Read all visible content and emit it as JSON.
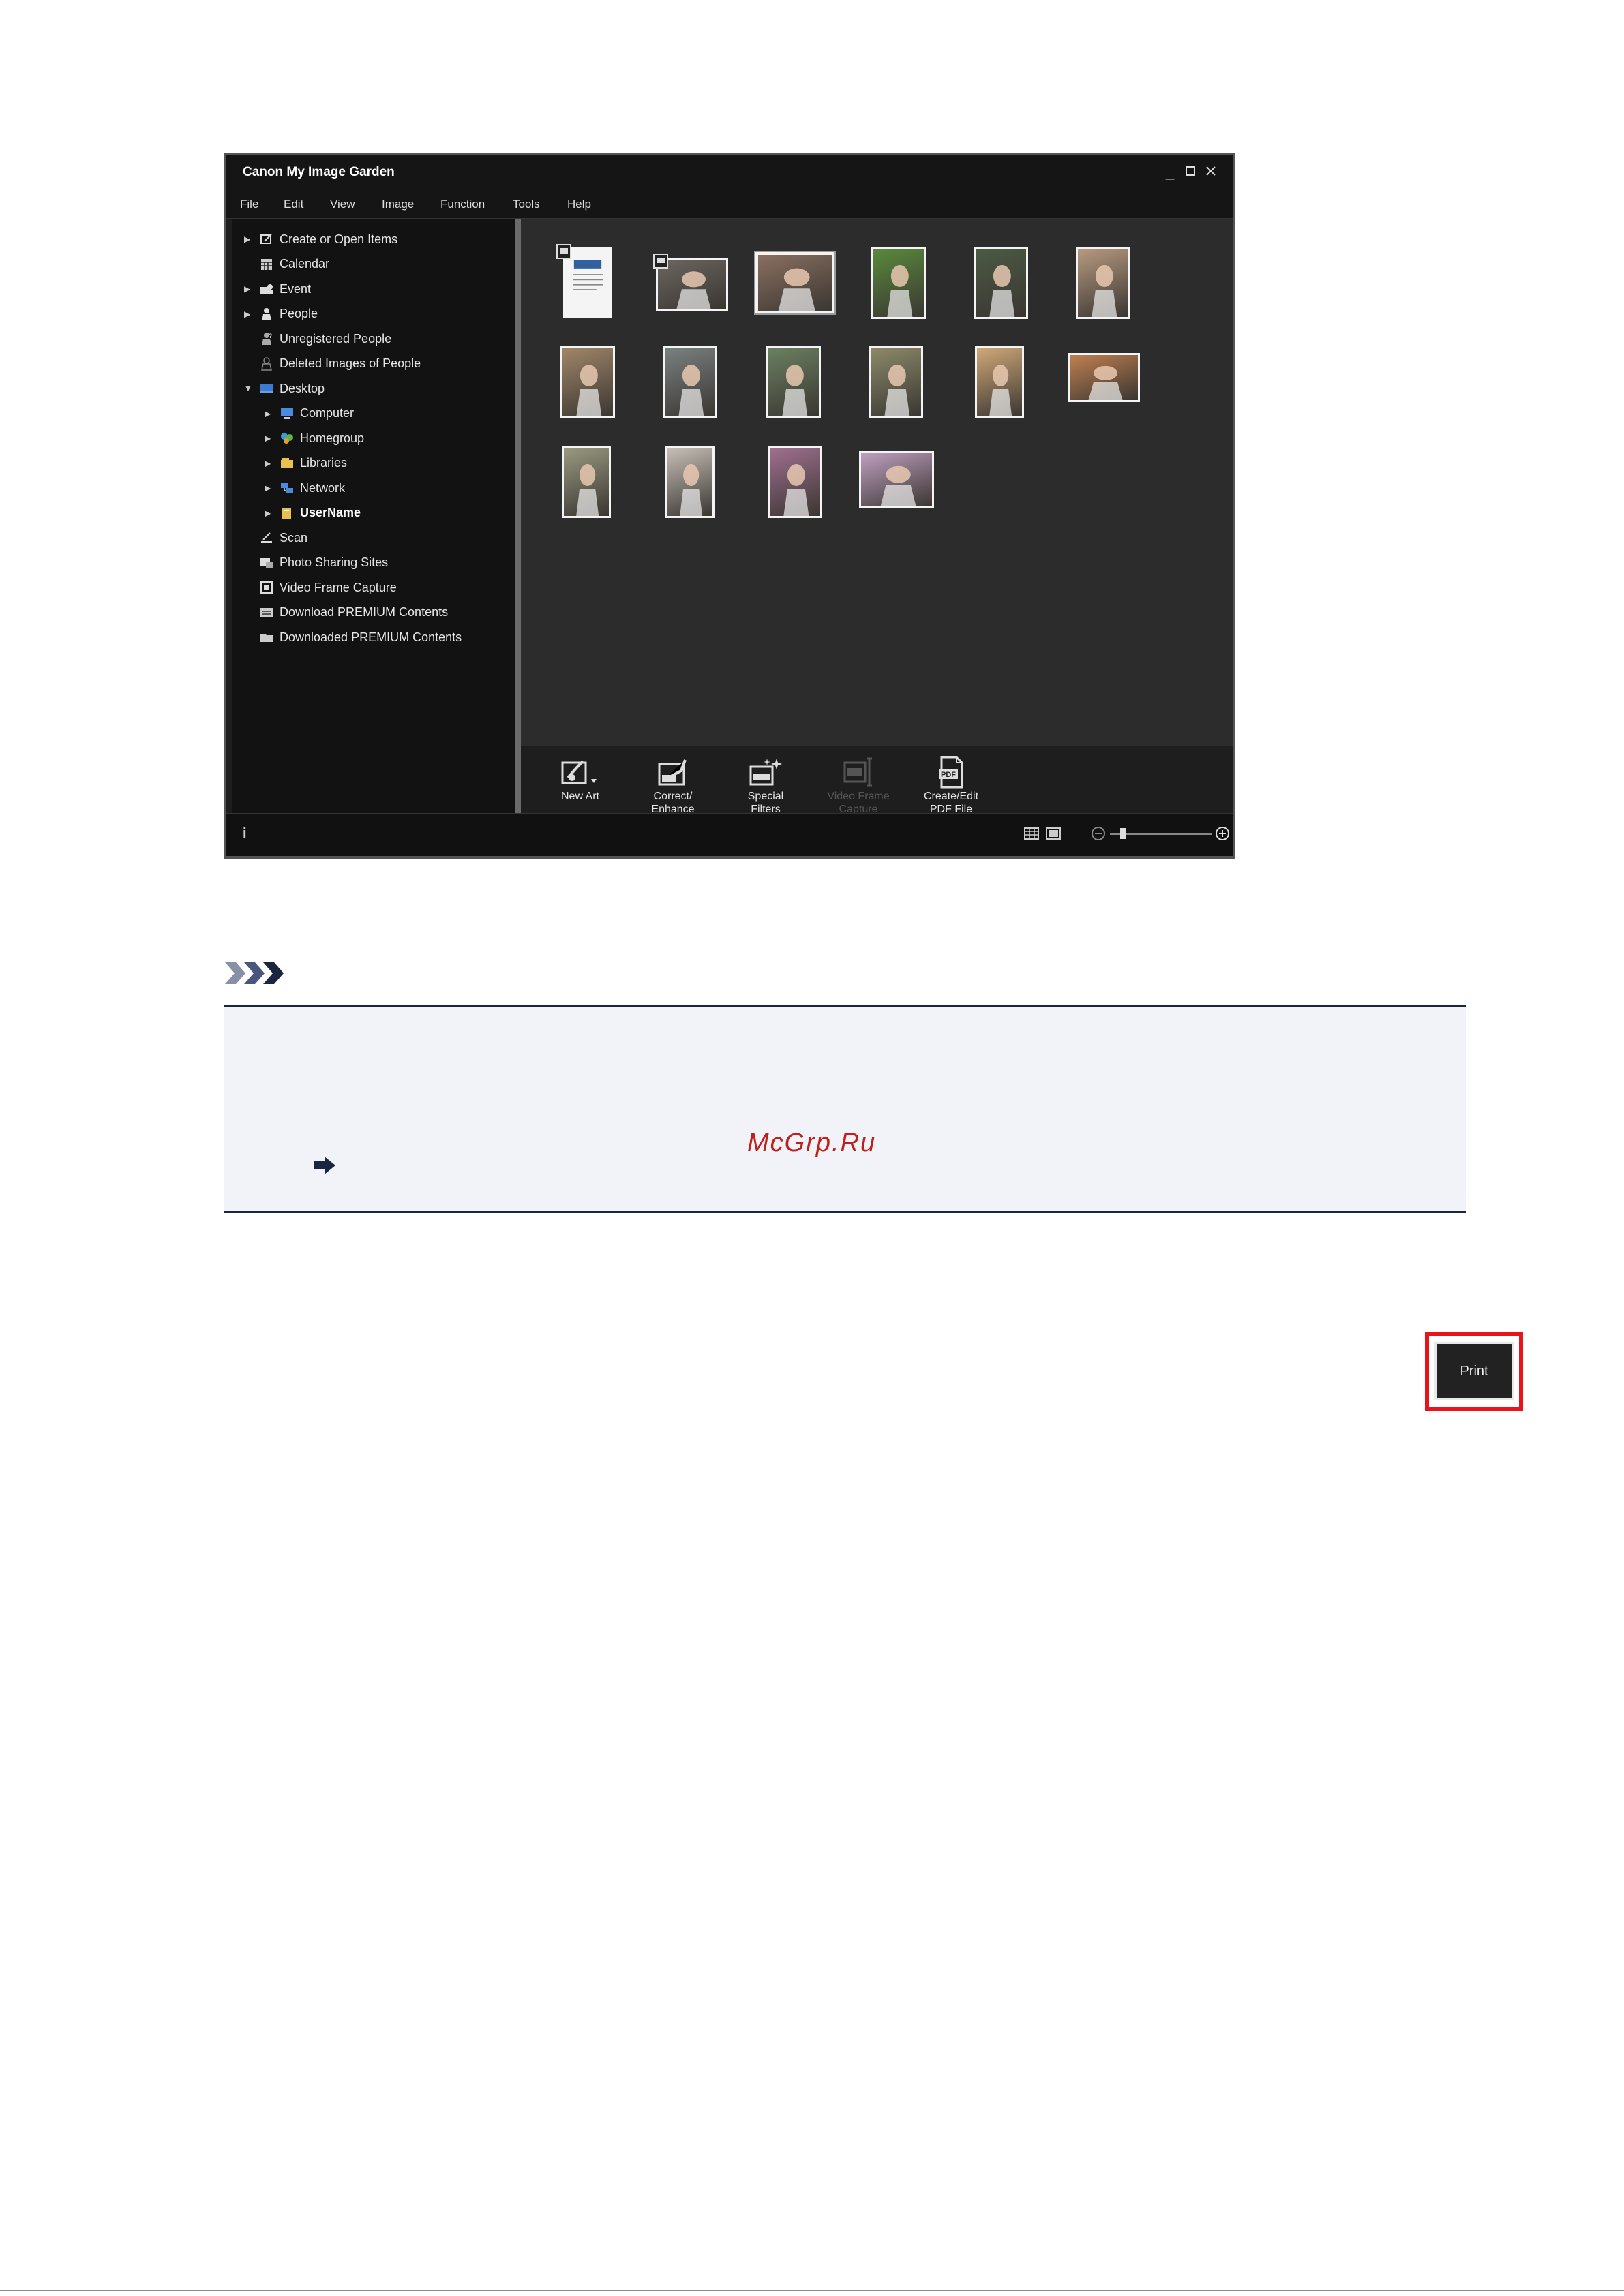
{
  "app": {
    "title": "Canon My Image Garden",
    "window_controls": [
      "minimize-icon",
      "maximize-icon",
      "close-icon"
    ]
  },
  "menu": [
    "File",
    "Edit",
    "View",
    "Image",
    "Function",
    "Tools",
    "Help"
  ],
  "sidebar": {
    "items": [
      {
        "label": "Create or Open Items",
        "expander": "collapsed",
        "icon": "create-items-icon",
        "indent": 0
      },
      {
        "label": "Calendar",
        "expander": "none",
        "icon": "calendar-icon",
        "indent": 0
      },
      {
        "label": "Event",
        "expander": "collapsed",
        "icon": "event-icon",
        "indent": 0
      },
      {
        "label": "People",
        "expander": "collapsed",
        "icon": "people-icon",
        "indent": 0
      },
      {
        "label": "Unregistered People",
        "expander": "none",
        "icon": "unregistered-people-icon",
        "indent": 0
      },
      {
        "label": "Deleted Images of People",
        "expander": "none",
        "icon": "deleted-people-icon",
        "indent": 0
      },
      {
        "label": "Desktop",
        "expander": "expanded",
        "icon": "desktop-icon",
        "indent": 0
      },
      {
        "label": "Computer",
        "expander": "collapsed",
        "icon": "computer-icon",
        "indent": 1
      },
      {
        "label": "Homegroup",
        "expander": "collapsed",
        "icon": "homegroup-icon",
        "indent": 1
      },
      {
        "label": "Libraries",
        "expander": "collapsed",
        "icon": "libraries-icon",
        "indent": 1
      },
      {
        "label": "Network",
        "expander": "collapsed",
        "icon": "network-icon",
        "indent": 1
      },
      {
        "label": "UserName",
        "expander": "collapsed",
        "icon": "user-folder-icon",
        "indent": 1,
        "bold": true
      },
      {
        "label": "Scan",
        "expander": "none",
        "icon": "scan-icon",
        "indent": 0
      },
      {
        "label": "Photo Sharing Sites",
        "expander": "none",
        "icon": "photo-sharing-icon",
        "indent": 0
      },
      {
        "label": "Video Frame Capture",
        "expander": "none",
        "icon": "video-frame-icon",
        "indent": 0
      },
      {
        "label": "Download PREMIUM Contents",
        "expander": "none",
        "icon": "download-premium-icon",
        "indent": 0
      },
      {
        "label": "Downloaded PREMIUM Contents",
        "expander": "none",
        "icon": "downloaded-premium-icon",
        "indent": 0
      }
    ]
  },
  "thumbnails": {
    "count": 16,
    "selected_index": 2,
    "colors": [
      "#e8e8e8",
      "#6b6660",
      "#8a7060",
      "#5a8a3c",
      "#4c5a44",
      "#b89a80",
      "#a08668",
      "#7a8080",
      "#6a8060",
      "#8c8a6a",
      "#d0a878",
      "#c08050",
      "#9a9a80",
      "#c8c0b8",
      "#a07090",
      "#c0a0c0"
    ]
  },
  "toolbar": {
    "tools": [
      {
        "label1": "New Art",
        "label2": "",
        "icon": "new-art-icon",
        "enabled": true
      },
      {
        "label1": "Correct/",
        "label2": "Enhance",
        "icon": "correct-enhance-icon",
        "enabled": true
      },
      {
        "label1": "Special",
        "label2": "Filters",
        "icon": "special-filters-icon",
        "enabled": true
      },
      {
        "label1": "Video Frame",
        "label2": "Capture",
        "icon": "video-frame-capture-icon",
        "enabled": false
      },
      {
        "label1": "Create/Edit",
        "label2": "PDF File",
        "icon": "pdf-icon",
        "enabled": true
      }
    ],
    "print_label": "Print",
    "print_highlight_color": "#e8141a"
  },
  "statusbar": {
    "info_icon": "i",
    "zoom_level": 0.1
  },
  "note": {
    "icon": "note-chevrons-icon",
    "accent_color": "#1a2540",
    "watermark": "McGrp.Ru"
  }
}
